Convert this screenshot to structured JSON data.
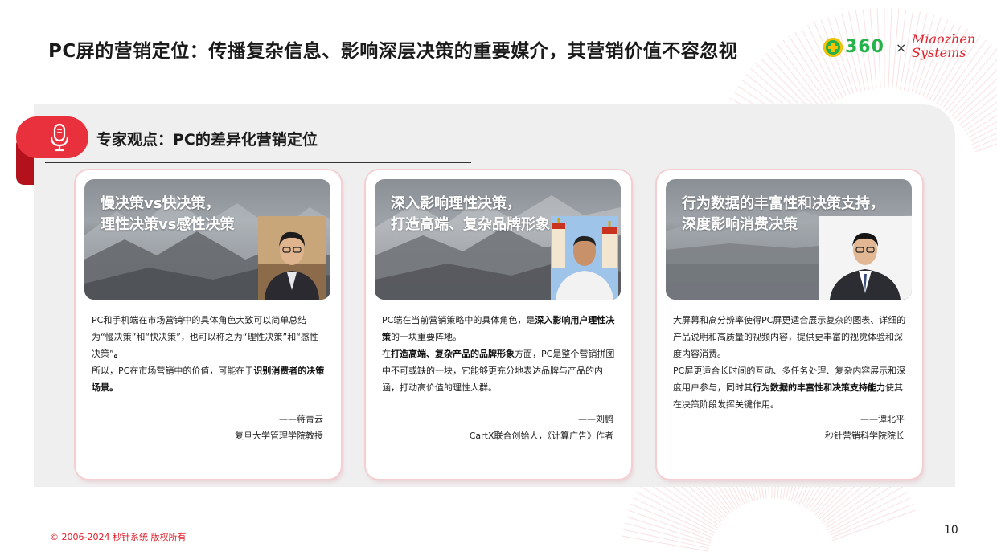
{
  "title": "PC屏的营销定位：传播复杂信息、影响深层决策的重要媒介，其营销价值不容忽视",
  "logos": {
    "brand_360": "360",
    "separator": "×",
    "miaozhen_line1": "Miaozhen",
    "miaozhen_line2": "Systems"
  },
  "section": {
    "icon": "microphone-icon",
    "heading": "专家观点：PC的差异化营销定位"
  },
  "cards": [
    {
      "banner_line1": "慢决策vs快决策，",
      "banner_line2": "理性决策vs感性决策",
      "body": [
        {
          "t": "PC和手机端在市场营销中的具体角色大致可以简单总结为“慢决策”和“快决策”，也可以称之为“理性决策”和“感性决策”",
          "b": false
        },
        {
          "t": "。",
          "b": true
        },
        {
          "t": "所以，PC在市场营销中的价值，可能在于",
          "b": false,
          "newline": true
        },
        {
          "t": "识别消费者的决策场景。",
          "b": true
        }
      ],
      "signature_name": "——蒋青云",
      "signature_title": "复旦大学管理学院教授"
    },
    {
      "banner_line1": "深入影响理性决策，",
      "banner_line2": "打造高端、复杂品牌形象",
      "body": [
        {
          "t": "PC端在当前营销策略中的具体角色，是",
          "b": false
        },
        {
          "t": "深入影响用户理性决策",
          "b": true
        },
        {
          "t": "的一块重要阵地。",
          "b": false
        },
        {
          "t": "在",
          "b": false,
          "newline": true
        },
        {
          "t": "打造高端、复杂产品的品牌形象",
          "b": true
        },
        {
          "t": "方面，PC是整个营销拼图中不可或缺的一块，它能够更充分地表达品牌与产品的内涵，打动高价值的理性人群。",
          "b": false
        }
      ],
      "signature_name": "——刘鹏",
      "signature_title": "CartX联合创始人，《计算广告》作者"
    },
    {
      "banner_line1": "行为数据的丰富性和决策支持，",
      "banner_line2": "深度影响消费决策",
      "body": [
        {
          "t": "大屏幕和高分辨率使得PC屏更适合展示复杂的图表、详细的产品说明和高质量的视频内容，提供更丰富的视觉体验和深度内容消费。",
          "b": false
        },
        {
          "t": "PC屏更适合长时间的互动、多任务处理、复杂内容展示和深度用户参与，同时其",
          "b": false,
          "newline": true
        },
        {
          "t": "行为数据的丰富性和决策支持能力",
          "b": true
        },
        {
          "t": "使其在决策阶段发挥关键作用。",
          "b": false
        }
      ],
      "signature_name": "——谭北平",
      "signature_title": "秒针营销科学院院长"
    }
  ],
  "footer": {
    "copyright": "© 2006-2024 秒针系统 版权所有",
    "page_number": "10"
  },
  "colors": {
    "accent_red": "#e8313c",
    "dark_red": "#b3121c",
    "brand_green": "#24b24b",
    "panel_gray": "#efeff0"
  }
}
